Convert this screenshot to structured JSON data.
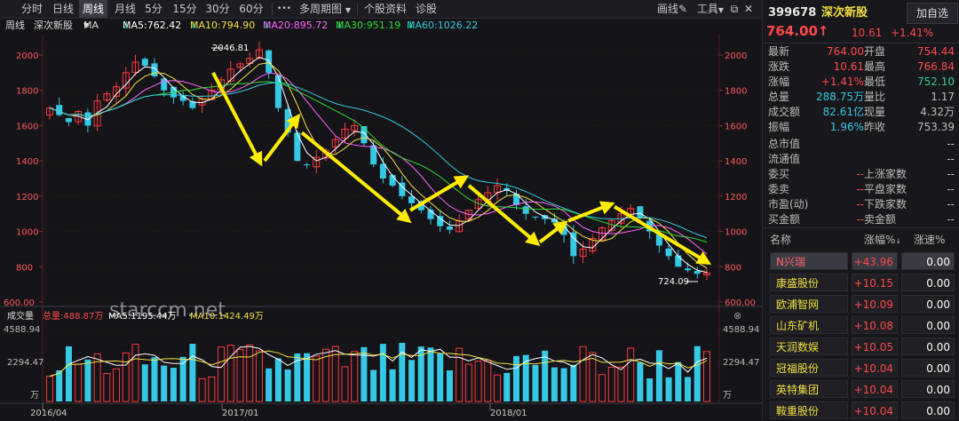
{
  "toolbar": {
    "tabs": [
      "分时",
      "日线",
      "周线",
      "月线",
      "5分",
      "15分",
      "30分",
      "60分"
    ],
    "more": "•••",
    "multi_period": "多周期图",
    "stock_info": "个股资料",
    "diagnose": "诊股",
    "draw": "画线",
    "tools": "工具"
  },
  "legend": {
    "period": "周线",
    "name": "深次新股",
    "ma_label": "MA",
    "ma5": "MA5:762.42",
    "ma10": "MA10:794.90",
    "ma20": "MA20:895.72",
    "ma30": "MA30:951.19",
    "ma60": "MA60:1026.22"
  },
  "colors": {
    "up": "#ff3b3b",
    "down": "#36c9e6",
    "ma5": "#ffffff",
    "ma10": "#f2e040",
    "ma20": "#ff66ff",
    "ma30": "#33dd33",
    "ma60": "#33ccdd",
    "arrow": "#ffeb00"
  },
  "price_axis": [
    "2000",
    "1800",
    "1600",
    "1400",
    "1200",
    "1000",
    "800",
    "600.00"
  ],
  "annotations": {
    "high": "2046.81",
    "low": "724.09"
  },
  "watermark": "starccm.net",
  "volume": {
    "title": "成交量",
    "total": "总量:488.87万",
    "ma5": "MA5:1195.44万",
    "ma10": "MA10:1424.49万",
    "axis_top": "4588.94",
    "axis_mid": "2294.47",
    "axis_unit": "万"
  },
  "dates": [
    "2016/04",
    "2017/01",
    "2018/01"
  ],
  "panel": {
    "code": "399678",
    "name": "深次新股",
    "add_button": "加自选",
    "price": "764.00",
    "change": "10.61",
    "change_pct": "+1.41%",
    "stats": [
      {
        "l1": "最新",
        "v1": "764.00",
        "l2": "开盘",
        "v2": "754.44"
      },
      {
        "l1": "涨跌",
        "v1": "10.61",
        "l2": "最高",
        "v2": "766.84"
      },
      {
        "l1": "涨幅",
        "v1": "+1.41%",
        "l2": "最低",
        "v2": "752.10"
      },
      {
        "l1": "总量",
        "v1": "288.75万",
        "l2": "量比",
        "v2": "1.17"
      },
      {
        "l1": "成交额",
        "v1": "82.61亿",
        "l2": "现量",
        "v2": "4.32万"
      },
      {
        "l1": "振幅",
        "v1": "1.96%",
        "l2": "昨收",
        "v2": "753.39"
      }
    ],
    "single": [
      {
        "l": "总市值",
        "v": "--"
      },
      {
        "l": "流通值",
        "v": "--"
      }
    ],
    "pairs": [
      {
        "l1": "委买",
        "v1": "--",
        "l2": "上涨家数",
        "v2": "--"
      },
      {
        "l1": "委卖",
        "v1": "--",
        "l2": "平盘家数",
        "v2": "--"
      },
      {
        "l1": "市盈(动)",
        "v1": "--",
        "l2": "下跌家数",
        "v2": "--"
      },
      {
        "l1": "买金额",
        "v1": "--",
        "l2": "卖金额",
        "v2": "--"
      }
    ],
    "table_headers": [
      "名称",
      "涨幅%",
      "涨速%"
    ],
    "rows": [
      {
        "name": "N兴瑞",
        "pct": "+43.96",
        "speed": "0.00"
      },
      {
        "name": "康盛股份",
        "pct": "+10.15",
        "speed": "0.00"
      },
      {
        "name": "欧浦智网",
        "pct": "+10.09",
        "speed": "0.00"
      },
      {
        "name": "山东矿机",
        "pct": "+10.08",
        "speed": "0.00"
      },
      {
        "name": "天润数娱",
        "pct": "+10.05",
        "speed": "0.00"
      },
      {
        "name": "冠福股份",
        "pct": "+10.04",
        "speed": "0.00"
      },
      {
        "name": "英特集团",
        "pct": "+10.04",
        "speed": "0.00"
      },
      {
        "name": "鞍重股份",
        "pct": "+10.04",
        "speed": "0.00"
      }
    ]
  },
  "chart_data": {
    "type": "candlestick",
    "title": "深次新股 周线",
    "period": "weekly",
    "date_ticks": [
      "2016/04",
      "2017/01",
      "2018/01"
    ],
    "ylim": [
      600,
      2100
    ],
    "y_ticks": [
      600,
      800,
      1000,
      1200,
      1400,
      1600,
      1800,
      2000
    ],
    "annotated_high": 2046.81,
    "annotated_low": 724.09,
    "last_close": 764.0,
    "ma_values": {
      "MA5": 762.42,
      "MA10": 794.9,
      "MA20": 895.72,
      "MA30": 951.19,
      "MA60": 1026.22
    },
    "close_trend": [
      1700,
      1660,
      1620,
      1680,
      1600,
      1740,
      1780,
      1820,
      1900,
      1960,
      1940,
      1880,
      1800,
      1760,
      1740,
      1700,
      1750,
      1800,
      1860,
      1920,
      1950,
      1980,
      2030,
      1900,
      1700,
      1560,
      1400,
      1380,
      1420,
      1460,
      1520,
      1580,
      1600,
      1500,
      1380,
      1300,
      1260,
      1200,
      1160,
      1120,
      1070,
      1030,
      1010,
      1060,
      1120,
      1180,
      1220,
      1260,
      1230,
      1150,
      1100,
      1080,
      1070,
      1050,
      980,
      860,
      900,
      960,
      1020,
      1060,
      1100,
      1130,
      1080,
      1000,
      920,
      860,
      800,
      780,
      760,
      764
    ],
    "volume_ylim": [
      0,
      4588.94
    ],
    "volume_unit": "万"
  }
}
